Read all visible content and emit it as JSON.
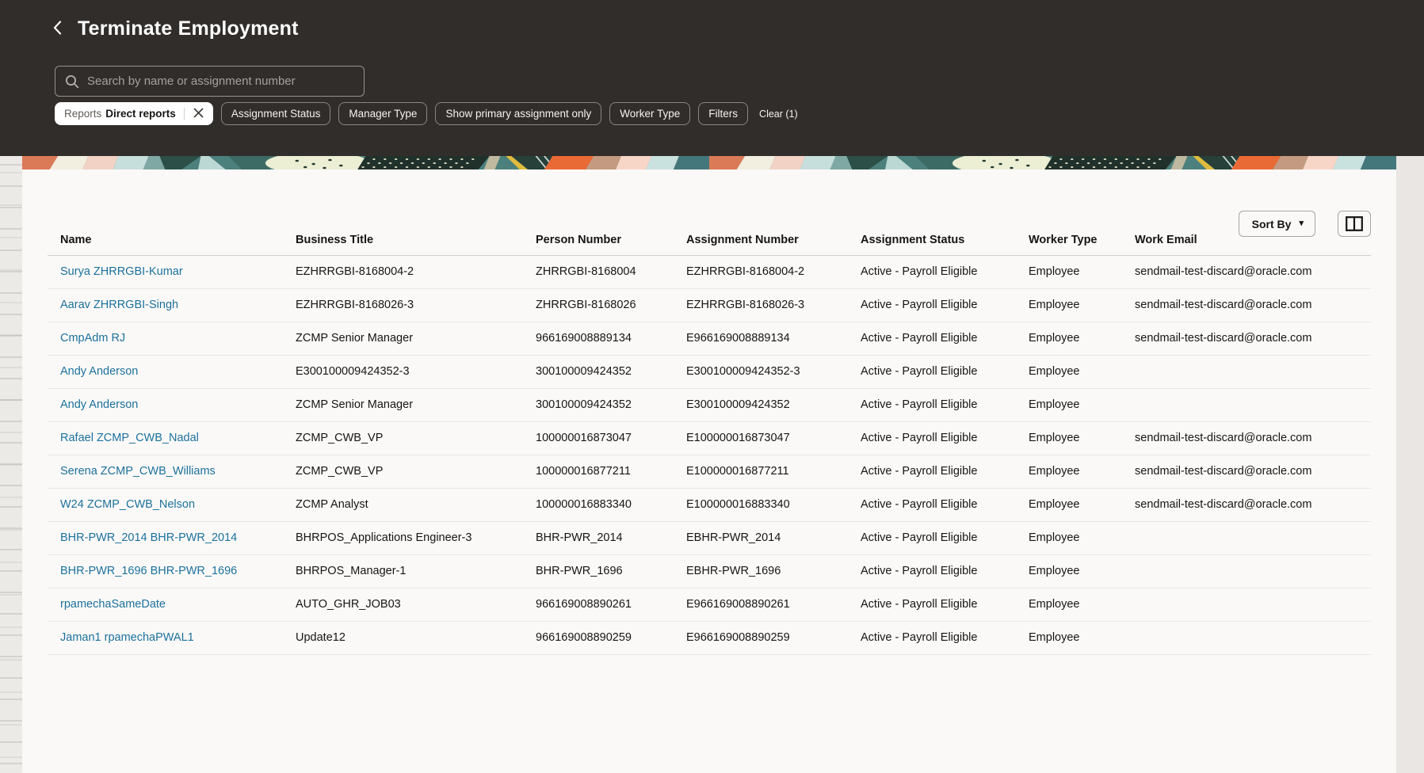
{
  "colors": {
    "header_bg": "#312d2a",
    "card_bg": "#fbf9f8",
    "page_bg": "#e9e6e3",
    "link": "#1b719c",
    "banner_teal": "#4b807d",
    "banner_orange": "#ea6a36"
  },
  "header": {
    "back_icon": "chevron-left",
    "title": "Terminate Employment",
    "search_placeholder": "Search by name or assignment number",
    "active_filter": {
      "label": "Reports",
      "value": "Direct reports",
      "remove_icon": "✕"
    },
    "chips": [
      "Assignment Status",
      "Manager Type",
      "Show primary assignment only",
      "Worker Type",
      "Filters"
    ],
    "clear_label": "Clear (1)"
  },
  "toolbar": {
    "sort_by": "Sort By",
    "sort_caret": "▾"
  },
  "table": {
    "columns": [
      "Name",
      "Business Title",
      "Person Number",
      "Assignment Number",
      "Assignment Status",
      "Worker Type",
      "Work Email"
    ],
    "rows": [
      {
        "name": "Surya ZHRRGBI-Kumar",
        "business_title": "EZHRRGBI-8168004-2",
        "person_number": "ZHRRGBI-8168004",
        "assignment_number": "EZHRRGBI-8168004-2",
        "assignment_status": "Active - Payroll Eligible",
        "worker_type": "Employee",
        "work_email": "sendmail-test-discard@oracle.com"
      },
      {
        "name": "Aarav ZHRRGBI-Singh",
        "business_title": "EZHRRGBI-8168026-3",
        "person_number": "ZHRRGBI-8168026",
        "assignment_number": "EZHRRGBI-8168026-3",
        "assignment_status": "Active - Payroll Eligible",
        "worker_type": "Employee",
        "work_email": "sendmail-test-discard@oracle.com"
      },
      {
        "name": "CmpAdm RJ",
        "business_title": "ZCMP Senior Manager",
        "person_number": "966169008889134",
        "assignment_number": "E966169008889134",
        "assignment_status": "Active - Payroll Eligible",
        "worker_type": "Employee",
        "work_email": "sendmail-test-discard@oracle.com"
      },
      {
        "name": "Andy Anderson",
        "business_title": "E300100009424352-3",
        "person_number": "300100009424352",
        "assignment_number": "E300100009424352-3",
        "assignment_status": "Active - Payroll Eligible",
        "worker_type": "Employee",
        "work_email": ""
      },
      {
        "name": "Andy Anderson",
        "business_title": "ZCMP Senior Manager",
        "person_number": "300100009424352",
        "assignment_number": "E300100009424352",
        "assignment_status": "Active - Payroll Eligible",
        "worker_type": "Employee",
        "work_email": ""
      },
      {
        "name": "Rafael ZCMP_CWB_Nadal",
        "business_title": "ZCMP_CWB_VP",
        "person_number": "100000016873047",
        "assignment_number": "E100000016873047",
        "assignment_status": "Active - Payroll Eligible",
        "worker_type": "Employee",
        "work_email": "sendmail-test-discard@oracle.com"
      },
      {
        "name": "Serena ZCMP_CWB_Williams",
        "business_title": "ZCMP_CWB_VP",
        "person_number": "100000016877211",
        "assignment_number": "E100000016877211",
        "assignment_status": "Active - Payroll Eligible",
        "worker_type": "Employee",
        "work_email": "sendmail-test-discard@oracle.com"
      },
      {
        "name": "W24 ZCMP_CWB_Nelson",
        "business_title": "ZCMP Analyst",
        "person_number": "100000016883340",
        "assignment_number": "E100000016883340",
        "assignment_status": "Active - Payroll Eligible",
        "worker_type": "Employee",
        "work_email": "sendmail-test-discard@oracle.com"
      },
      {
        "name": "BHR-PWR_2014 BHR-PWR_2014",
        "business_title": "BHRPOS_Applications Engineer-3",
        "person_number": "BHR-PWR_2014",
        "assignment_number": "EBHR-PWR_2014",
        "assignment_status": "Active - Payroll Eligible",
        "worker_type": "Employee",
        "work_email": ""
      },
      {
        "name": "BHR-PWR_1696 BHR-PWR_1696",
        "business_title": "BHRPOS_Manager-1",
        "person_number": "BHR-PWR_1696",
        "assignment_number": "EBHR-PWR_1696",
        "assignment_status": "Active - Payroll Eligible",
        "worker_type": "Employee",
        "work_email": ""
      },
      {
        "name": "rpamechaSameDate",
        "business_title": "AUTO_GHR_JOB03",
        "person_number": "966169008890261",
        "assignment_number": "E966169008890261",
        "assignment_status": "Active - Payroll Eligible",
        "worker_type": "Employee",
        "work_email": ""
      },
      {
        "name": "Jaman1 rpamechaPWAL1",
        "business_title": "Update12",
        "person_number": "966169008890259",
        "assignment_number": "E966169008890259",
        "assignment_status": "Active - Payroll Eligible",
        "worker_type": "Employee",
        "work_email": ""
      }
    ]
  }
}
